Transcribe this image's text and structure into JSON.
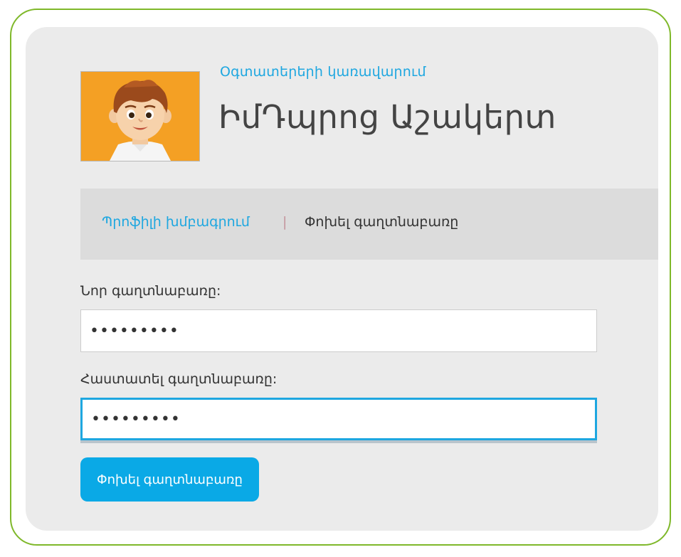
{
  "header": {
    "subtitle": "Օգտատերերի կառավարում",
    "title": "ԻմԴպրոց Աշակերտ"
  },
  "avatar": {
    "icon": "student-avatar-icon",
    "background_color": "#f4a024"
  },
  "tabs": {
    "edit_profile": "Պրոֆիլի խմբագրում",
    "separator": "|",
    "change_password": "Փոխել գաղտնաբառը"
  },
  "form": {
    "new_password_label": "Նոր գաղտնաբառը:",
    "new_password_value": "•••••••••",
    "confirm_password_label": "Հաստատել գաղտնաբառը:",
    "confirm_password_value": "•••••••••",
    "submit_label": "Փոխել գաղտնաբառը"
  },
  "colors": {
    "accent": "#1ea7e0",
    "button": "#0aa9e6",
    "frame": "#7fb82a"
  }
}
